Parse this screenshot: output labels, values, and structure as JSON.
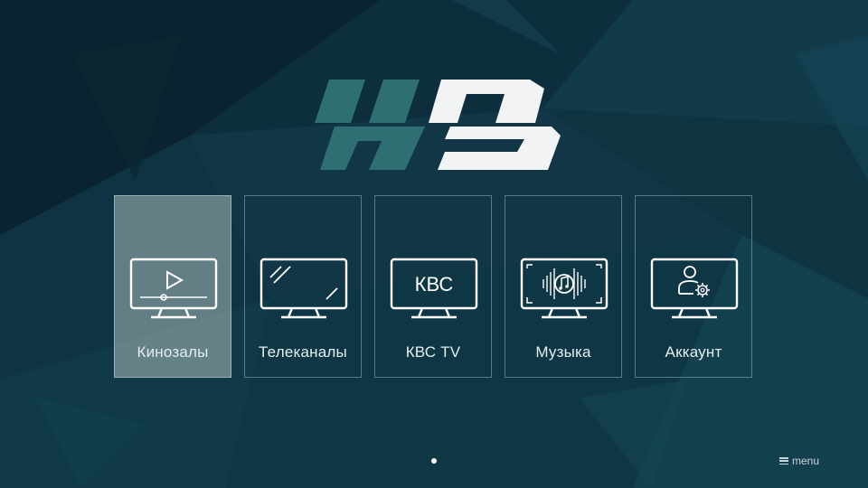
{
  "logo": {
    "text": "HD",
    "colors": {
      "top_left": "#2e6f74",
      "top_right": "#f1f3f4",
      "bottom_left": "#2e6f74",
      "bottom_right": "#f1f3f4"
    }
  },
  "tiles": [
    {
      "label": "Кинозалы",
      "icon": "tv-play-icon",
      "selected": true
    },
    {
      "label": "Телеканалы",
      "icon": "tv-screen-icon",
      "selected": false
    },
    {
      "label": "КВС TV",
      "icon": "tv-kbc-icon",
      "icon_text": "КВС",
      "selected": false
    },
    {
      "label": "Музыка",
      "icon": "tv-music-icon",
      "selected": false
    },
    {
      "label": "Аккаунт",
      "icon": "tv-account-icon",
      "selected": false
    }
  ],
  "pagination": {
    "current": 1,
    "total": 1
  },
  "menu_hint": {
    "label": "menu",
    "icon": "hamburger-icon"
  },
  "colors": {
    "background": "#0c2b36",
    "selected_tile": "#8fa3a3",
    "tile_border": "#b4cdd2",
    "text": "#e6eef0"
  }
}
